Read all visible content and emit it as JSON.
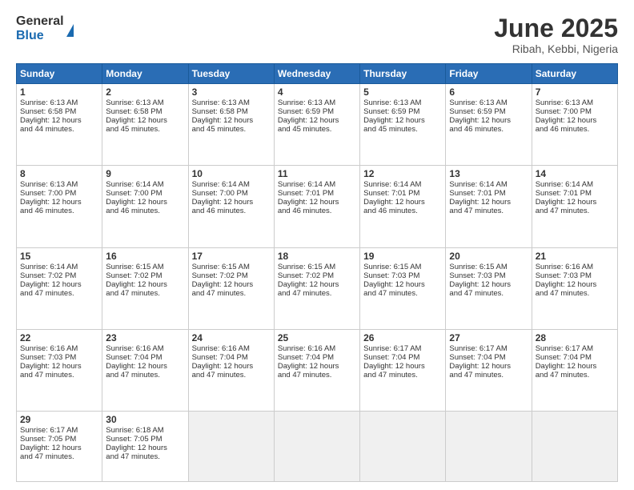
{
  "header": {
    "logo_line1": "General",
    "logo_line2": "Blue",
    "month_title": "June 2025",
    "location": "Ribah, Kebbi, Nigeria"
  },
  "days_of_week": [
    "Sunday",
    "Monday",
    "Tuesday",
    "Wednesday",
    "Thursday",
    "Friday",
    "Saturday"
  ],
  "weeks": [
    [
      {
        "day": "1",
        "lines": [
          "Sunrise: 6:13 AM",
          "Sunset: 6:58 PM",
          "Daylight: 12 hours",
          "and 44 minutes."
        ]
      },
      {
        "day": "2",
        "lines": [
          "Sunrise: 6:13 AM",
          "Sunset: 6:58 PM",
          "Daylight: 12 hours",
          "and 45 minutes."
        ]
      },
      {
        "day": "3",
        "lines": [
          "Sunrise: 6:13 AM",
          "Sunset: 6:58 PM",
          "Daylight: 12 hours",
          "and 45 minutes."
        ]
      },
      {
        "day": "4",
        "lines": [
          "Sunrise: 6:13 AM",
          "Sunset: 6:59 PM",
          "Daylight: 12 hours",
          "and 45 minutes."
        ]
      },
      {
        "day": "5",
        "lines": [
          "Sunrise: 6:13 AM",
          "Sunset: 6:59 PM",
          "Daylight: 12 hours",
          "and 45 minutes."
        ]
      },
      {
        "day": "6",
        "lines": [
          "Sunrise: 6:13 AM",
          "Sunset: 6:59 PM",
          "Daylight: 12 hours",
          "and 46 minutes."
        ]
      },
      {
        "day": "7",
        "lines": [
          "Sunrise: 6:13 AM",
          "Sunset: 7:00 PM",
          "Daylight: 12 hours",
          "and 46 minutes."
        ]
      }
    ],
    [
      {
        "day": "8",
        "lines": [
          "Sunrise: 6:13 AM",
          "Sunset: 7:00 PM",
          "Daylight: 12 hours",
          "and 46 minutes."
        ]
      },
      {
        "day": "9",
        "lines": [
          "Sunrise: 6:14 AM",
          "Sunset: 7:00 PM",
          "Daylight: 12 hours",
          "and 46 minutes."
        ]
      },
      {
        "day": "10",
        "lines": [
          "Sunrise: 6:14 AM",
          "Sunset: 7:00 PM",
          "Daylight: 12 hours",
          "and 46 minutes."
        ]
      },
      {
        "day": "11",
        "lines": [
          "Sunrise: 6:14 AM",
          "Sunset: 7:01 PM",
          "Daylight: 12 hours",
          "and 46 minutes."
        ]
      },
      {
        "day": "12",
        "lines": [
          "Sunrise: 6:14 AM",
          "Sunset: 7:01 PM",
          "Daylight: 12 hours",
          "and 46 minutes."
        ]
      },
      {
        "day": "13",
        "lines": [
          "Sunrise: 6:14 AM",
          "Sunset: 7:01 PM",
          "Daylight: 12 hours",
          "and 47 minutes."
        ]
      },
      {
        "day": "14",
        "lines": [
          "Sunrise: 6:14 AM",
          "Sunset: 7:01 PM",
          "Daylight: 12 hours",
          "and 47 minutes."
        ]
      }
    ],
    [
      {
        "day": "15",
        "lines": [
          "Sunrise: 6:14 AM",
          "Sunset: 7:02 PM",
          "Daylight: 12 hours",
          "and 47 minutes."
        ]
      },
      {
        "day": "16",
        "lines": [
          "Sunrise: 6:15 AM",
          "Sunset: 7:02 PM",
          "Daylight: 12 hours",
          "and 47 minutes."
        ]
      },
      {
        "day": "17",
        "lines": [
          "Sunrise: 6:15 AM",
          "Sunset: 7:02 PM",
          "Daylight: 12 hours",
          "and 47 minutes."
        ]
      },
      {
        "day": "18",
        "lines": [
          "Sunrise: 6:15 AM",
          "Sunset: 7:02 PM",
          "Daylight: 12 hours",
          "and 47 minutes."
        ]
      },
      {
        "day": "19",
        "lines": [
          "Sunrise: 6:15 AM",
          "Sunset: 7:03 PM",
          "Daylight: 12 hours",
          "and 47 minutes."
        ]
      },
      {
        "day": "20",
        "lines": [
          "Sunrise: 6:15 AM",
          "Sunset: 7:03 PM",
          "Daylight: 12 hours",
          "and 47 minutes."
        ]
      },
      {
        "day": "21",
        "lines": [
          "Sunrise: 6:16 AM",
          "Sunset: 7:03 PM",
          "Daylight: 12 hours",
          "and 47 minutes."
        ]
      }
    ],
    [
      {
        "day": "22",
        "lines": [
          "Sunrise: 6:16 AM",
          "Sunset: 7:03 PM",
          "Daylight: 12 hours",
          "and 47 minutes."
        ]
      },
      {
        "day": "23",
        "lines": [
          "Sunrise: 6:16 AM",
          "Sunset: 7:04 PM",
          "Daylight: 12 hours",
          "and 47 minutes."
        ]
      },
      {
        "day": "24",
        "lines": [
          "Sunrise: 6:16 AM",
          "Sunset: 7:04 PM",
          "Daylight: 12 hours",
          "and 47 minutes."
        ]
      },
      {
        "day": "25",
        "lines": [
          "Sunrise: 6:16 AM",
          "Sunset: 7:04 PM",
          "Daylight: 12 hours",
          "and 47 minutes."
        ]
      },
      {
        "day": "26",
        "lines": [
          "Sunrise: 6:17 AM",
          "Sunset: 7:04 PM",
          "Daylight: 12 hours",
          "and 47 minutes."
        ]
      },
      {
        "day": "27",
        "lines": [
          "Sunrise: 6:17 AM",
          "Sunset: 7:04 PM",
          "Daylight: 12 hours",
          "and 47 minutes."
        ]
      },
      {
        "day": "28",
        "lines": [
          "Sunrise: 6:17 AM",
          "Sunset: 7:04 PM",
          "Daylight: 12 hours",
          "and 47 minutes."
        ]
      }
    ],
    [
      {
        "day": "29",
        "lines": [
          "Sunrise: 6:17 AM",
          "Sunset: 7:05 PM",
          "Daylight: 12 hours",
          "and 47 minutes."
        ]
      },
      {
        "day": "30",
        "lines": [
          "Sunrise: 6:18 AM",
          "Sunset: 7:05 PM",
          "Daylight: 12 hours",
          "and 47 minutes."
        ]
      },
      {
        "day": "",
        "lines": []
      },
      {
        "day": "",
        "lines": []
      },
      {
        "day": "",
        "lines": []
      },
      {
        "day": "",
        "lines": []
      },
      {
        "day": "",
        "lines": []
      }
    ]
  ]
}
